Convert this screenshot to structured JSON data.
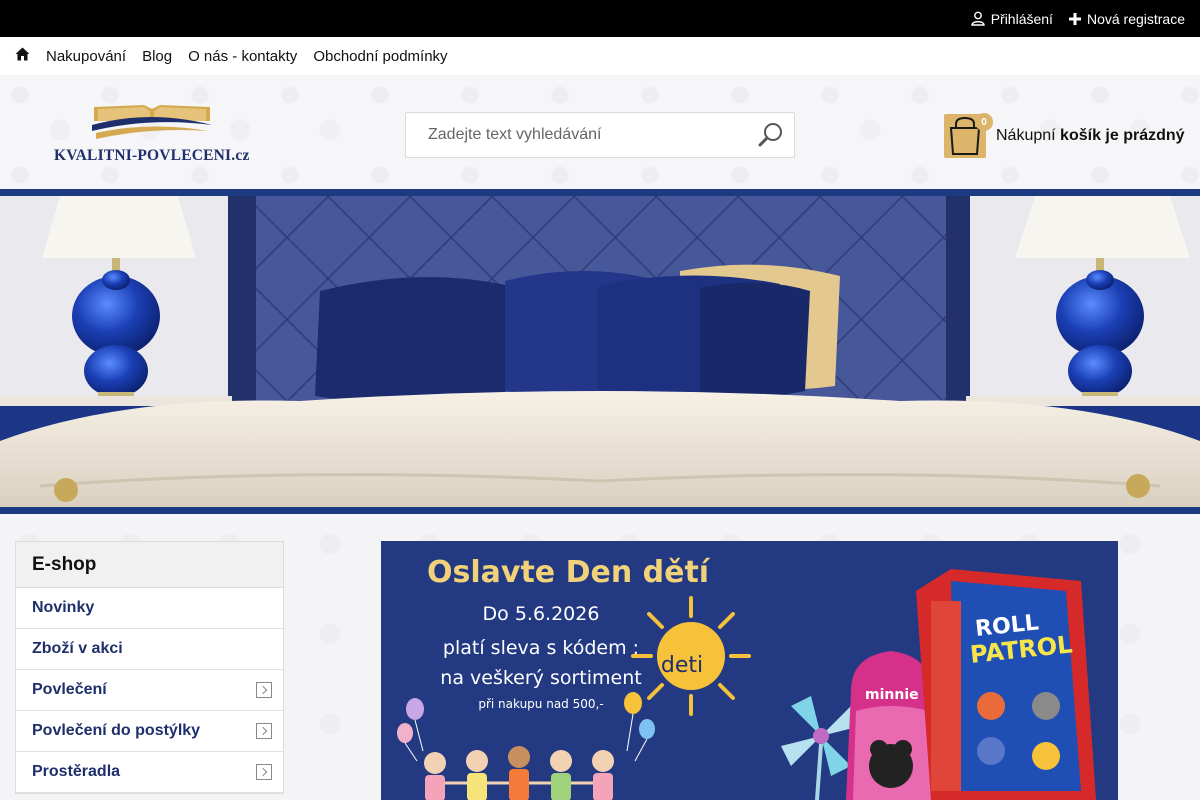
{
  "topbar": {
    "login_label": "Přihlášení",
    "register_label": "Nová registrace"
  },
  "nav": {
    "items": [
      "Nakupování",
      "Blog",
      "O nás - kontakty",
      "Obchodní podmínky"
    ]
  },
  "header": {
    "logo_text": "KVALITNI-POVLECENI.cz",
    "search_placeholder": "Zadejte text vyhledávání",
    "cart_count": "0",
    "cart_label": "Nákupní",
    "cart_status": "košík je prázdný"
  },
  "sidebar": {
    "title": "E-shop",
    "items": [
      {
        "label": "Novinky"
      },
      {
        "label": "Zboží v akci"
      },
      {
        "label": "Povlečení"
      },
      {
        "label": "Povlečení do postýlky"
      },
      {
        "label": "Prostěradla"
      }
    ]
  },
  "promo": {
    "headline": "Oslavte Den dětí",
    "line1": "Do 5.6.2026",
    "line2": "platí sleva s kódem :",
    "line3": "na veškerý sortiment",
    "line4": "při nakupu nad 500,-",
    "sun_text": "deti",
    "product_text_1": "ROLL",
    "product_text_2": "PATROL",
    "product_text_3": "minnie"
  },
  "colors": {
    "brand_navy": "#1e2f6b",
    "banner_blue": "#1b3a82",
    "gold": "#dcb46a",
    "promo_bg": "#233a82",
    "promo_heading": "#f1d27a"
  }
}
